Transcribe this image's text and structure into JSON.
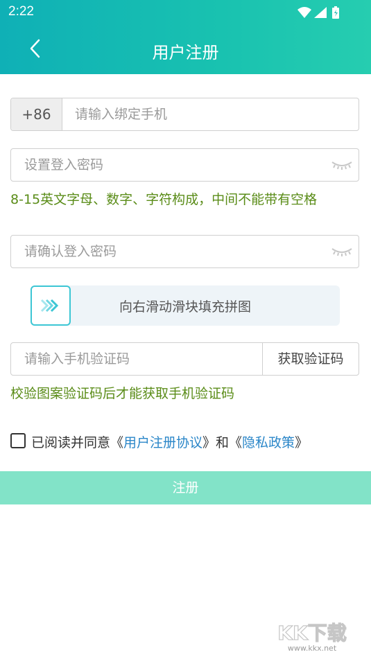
{
  "status_bar": {
    "time": "2:22"
  },
  "header": {
    "title": "用户注册"
  },
  "phone": {
    "country_code": "+86",
    "placeholder": "请输入绑定手机"
  },
  "password": {
    "placeholder": "设置登入密码",
    "hint": "8-15英文字母、数字、字符构成，中间不能带有空格"
  },
  "confirm_password": {
    "placeholder": "请确认登入密码"
  },
  "slider": {
    "label": "向右滑动滑块填充拼图"
  },
  "sms": {
    "placeholder": "请输入手机验证码",
    "button_label": "获取验证码",
    "hint": "校验图案验证码后才能获取手机验证码"
  },
  "agreement": {
    "prefix": "已阅读并同意《",
    "terms_link": "用户注册协议",
    "middle": "》和《",
    "privacy_link": "隐私政策",
    "suffix": "》",
    "checked": false
  },
  "submit_label": "注册",
  "watermark": {
    "brand": "KK下载",
    "url": "www.kkx.net"
  },
  "colors": {
    "accent": "#19c2b0",
    "hint_green": "#5a8c18",
    "link_blue": "#2a86c8",
    "submit_bg": "#82e3c8"
  }
}
